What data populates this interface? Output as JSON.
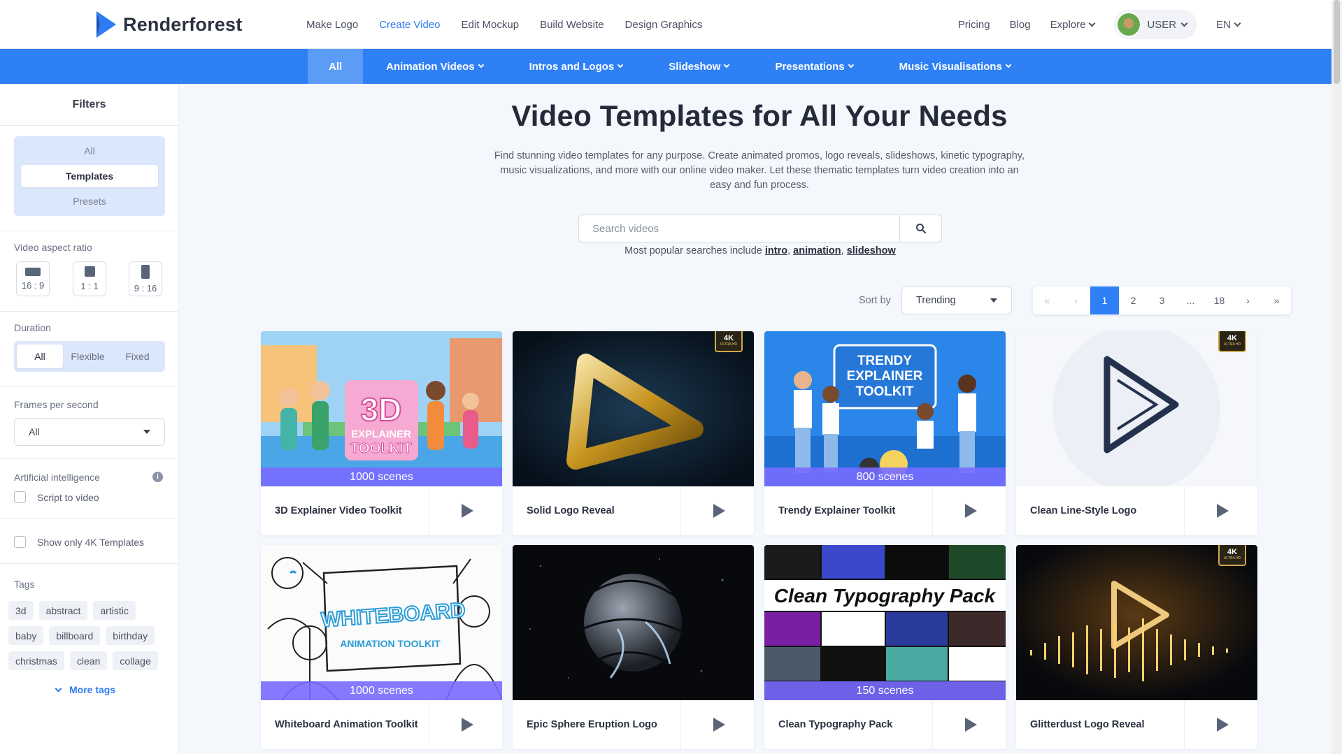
{
  "brand": {
    "name": "Renderforest"
  },
  "mainnav": [
    "Make Logo",
    "Create Video",
    "Edit Mockup",
    "Build Website",
    "Design Graphics"
  ],
  "mainnav_active": "Create Video",
  "rightnav": {
    "pricing": "Pricing",
    "blog": "Blog",
    "explore": "Explore",
    "user": "USER",
    "lang": "EN"
  },
  "categories": [
    "All",
    "Animation Videos",
    "Intros and Logos",
    "Slideshow",
    "Presentations",
    "Music Visualisations"
  ],
  "sidebar": {
    "title": "Filters",
    "type_options": [
      "All",
      "Templates",
      "Presets"
    ],
    "type_selected": "Templates",
    "aspect_label": "Video aspect ratio",
    "aspect_ratios": [
      "16 : 9",
      "1 : 1",
      "9 : 16"
    ],
    "duration_label": "Duration",
    "duration_options": [
      "All",
      "Flexible",
      "Fixed"
    ],
    "duration_selected": "All",
    "fps_label": "Frames per second",
    "fps_value": "All",
    "ai_label": "Artificial intelligence",
    "ai_info": "i",
    "script_to_video": "Script to video",
    "show_4k": "Show only 4K Templates",
    "tags_label": "Tags",
    "tags": [
      "3d",
      "abstract",
      "artistic",
      "baby",
      "billboard",
      "birthday",
      "christmas",
      "clean",
      "collage"
    ],
    "more_tags": "More tags"
  },
  "hero": {
    "title": "Video Templates for All Your Needs",
    "description": "Find stunning video templates for any purpose. Create animated promos, logo reveals, slideshows, kinetic typography, music visualizations, and more with our online video maker. Let these thematic templates turn video creation into an easy and fun process."
  },
  "search": {
    "placeholder": "Search videos",
    "popular_prefix": "Most popular searches include",
    "popular_links": [
      "intro",
      "animation",
      "slideshow"
    ]
  },
  "sort": {
    "label": "Sort by",
    "value": "Trending"
  },
  "pagination": {
    "pages": [
      "1",
      "2",
      "3",
      "...",
      "18"
    ],
    "current": "1"
  },
  "badge": {
    "k4": "4K",
    "uhd": "ULTRA HD"
  },
  "cards": [
    {
      "title": "3D Explainer Video Toolkit",
      "scenes": "1000 scenes",
      "is4k": false,
      "art": "3d",
      "art_text": [
        "3D",
        "EXPLAINER",
        "TOOLKIT"
      ]
    },
    {
      "title": "Solid Logo Reveal",
      "scenes": "",
      "is4k": true,
      "art": "gold",
      "art_text": []
    },
    {
      "title": "Trendy Explainer Toolkit",
      "scenes": "800 scenes",
      "is4k": false,
      "art": "trendy",
      "art_text": [
        "TRENDY",
        "EXPLAINER",
        "TOOLKIT"
      ]
    },
    {
      "title": "Clean Line-Style Logo",
      "scenes": "",
      "is4k": true,
      "art": "line",
      "art_text": []
    },
    {
      "title": "Whiteboard Animation Toolkit",
      "scenes": "1000 scenes",
      "is4k": false,
      "art": "whiteboard",
      "art_text": [
        "WHITEBOARD",
        "ANIMATION  TOOLKIT"
      ]
    },
    {
      "title": "Epic Sphere Eruption Logo",
      "scenes": "",
      "is4k": false,
      "art": "sphere",
      "art_text": []
    },
    {
      "title": "Clean Typography Pack",
      "scenes": "150 scenes",
      "is4k": false,
      "art": "typo",
      "art_text": [
        "Clean Typography Pack"
      ]
    },
    {
      "title": "Glitterdust Logo Reveal",
      "scenes": "",
      "is4k": true,
      "art": "glitter",
      "art_text": []
    }
  ]
}
